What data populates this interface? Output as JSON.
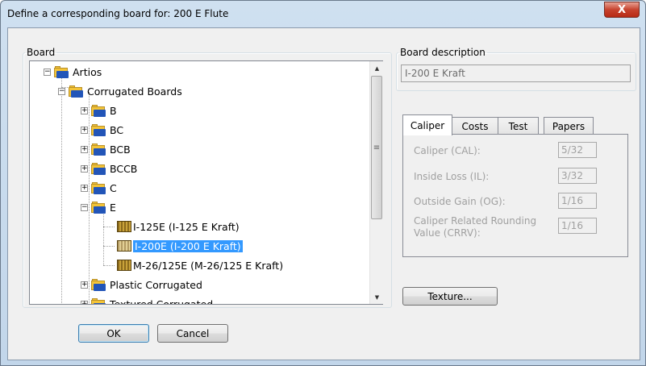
{
  "window": {
    "title": "Define a corresponding board for: 200 E Flute",
    "close_glyph": "X"
  },
  "board_group": {
    "legend": "Board",
    "tree": [
      {
        "label": "Artios",
        "type": "folder",
        "expander": "−"
      },
      {
        "label": "Corrugated Boards",
        "type": "folder",
        "expander": "−"
      },
      {
        "label": "B",
        "type": "folder",
        "expander": "+"
      },
      {
        "label": "BC",
        "type": "folder",
        "expander": "+"
      },
      {
        "label": "BCB",
        "type": "folder",
        "expander": "+"
      },
      {
        "label": "BCCB",
        "type": "folder",
        "expander": "+"
      },
      {
        "label": "C",
        "type": "folder",
        "expander": "+"
      },
      {
        "label": "E",
        "type": "folder",
        "expander": "−"
      },
      {
        "label": "I-125E (I-125 E Kraft)",
        "type": "board"
      },
      {
        "label": "I-200E (I-200 E Kraft)",
        "type": "board",
        "selected": true
      },
      {
        "label": "M-26/125E (M-26/125 E Kraft)",
        "type": "board"
      },
      {
        "label": "Plastic Corrugated",
        "type": "folder",
        "expander": "+"
      },
      {
        "label": "Textured Corrugated",
        "type": "folder",
        "expander": "+"
      }
    ],
    "scroll_up": "▲",
    "scroll_down": "▼",
    "thumb_grip": "≡"
  },
  "description_group": {
    "legend": "Board description",
    "value": "I-200 E Kraft"
  },
  "tabs": [
    "Caliper",
    "Costs",
    "Test",
    "Papers"
  ],
  "active_tab": "Caliper",
  "caliper": {
    "fields": [
      {
        "label": "Caliper (CAL):",
        "value": "5/32"
      },
      {
        "label": "Inside Loss (IL):",
        "value": "3/32"
      },
      {
        "label": "Outside Gain (OG):",
        "value": "1/16"
      },
      {
        "label": "Caliper Related Rounding Value (CRRV):",
        "value": "1/16"
      }
    ]
  },
  "buttons": {
    "texture": "Texture...",
    "ok": "OK",
    "cancel": "Cancel"
  },
  "colors": {
    "selection": "#3399ff",
    "close_button": "#c7432e"
  }
}
